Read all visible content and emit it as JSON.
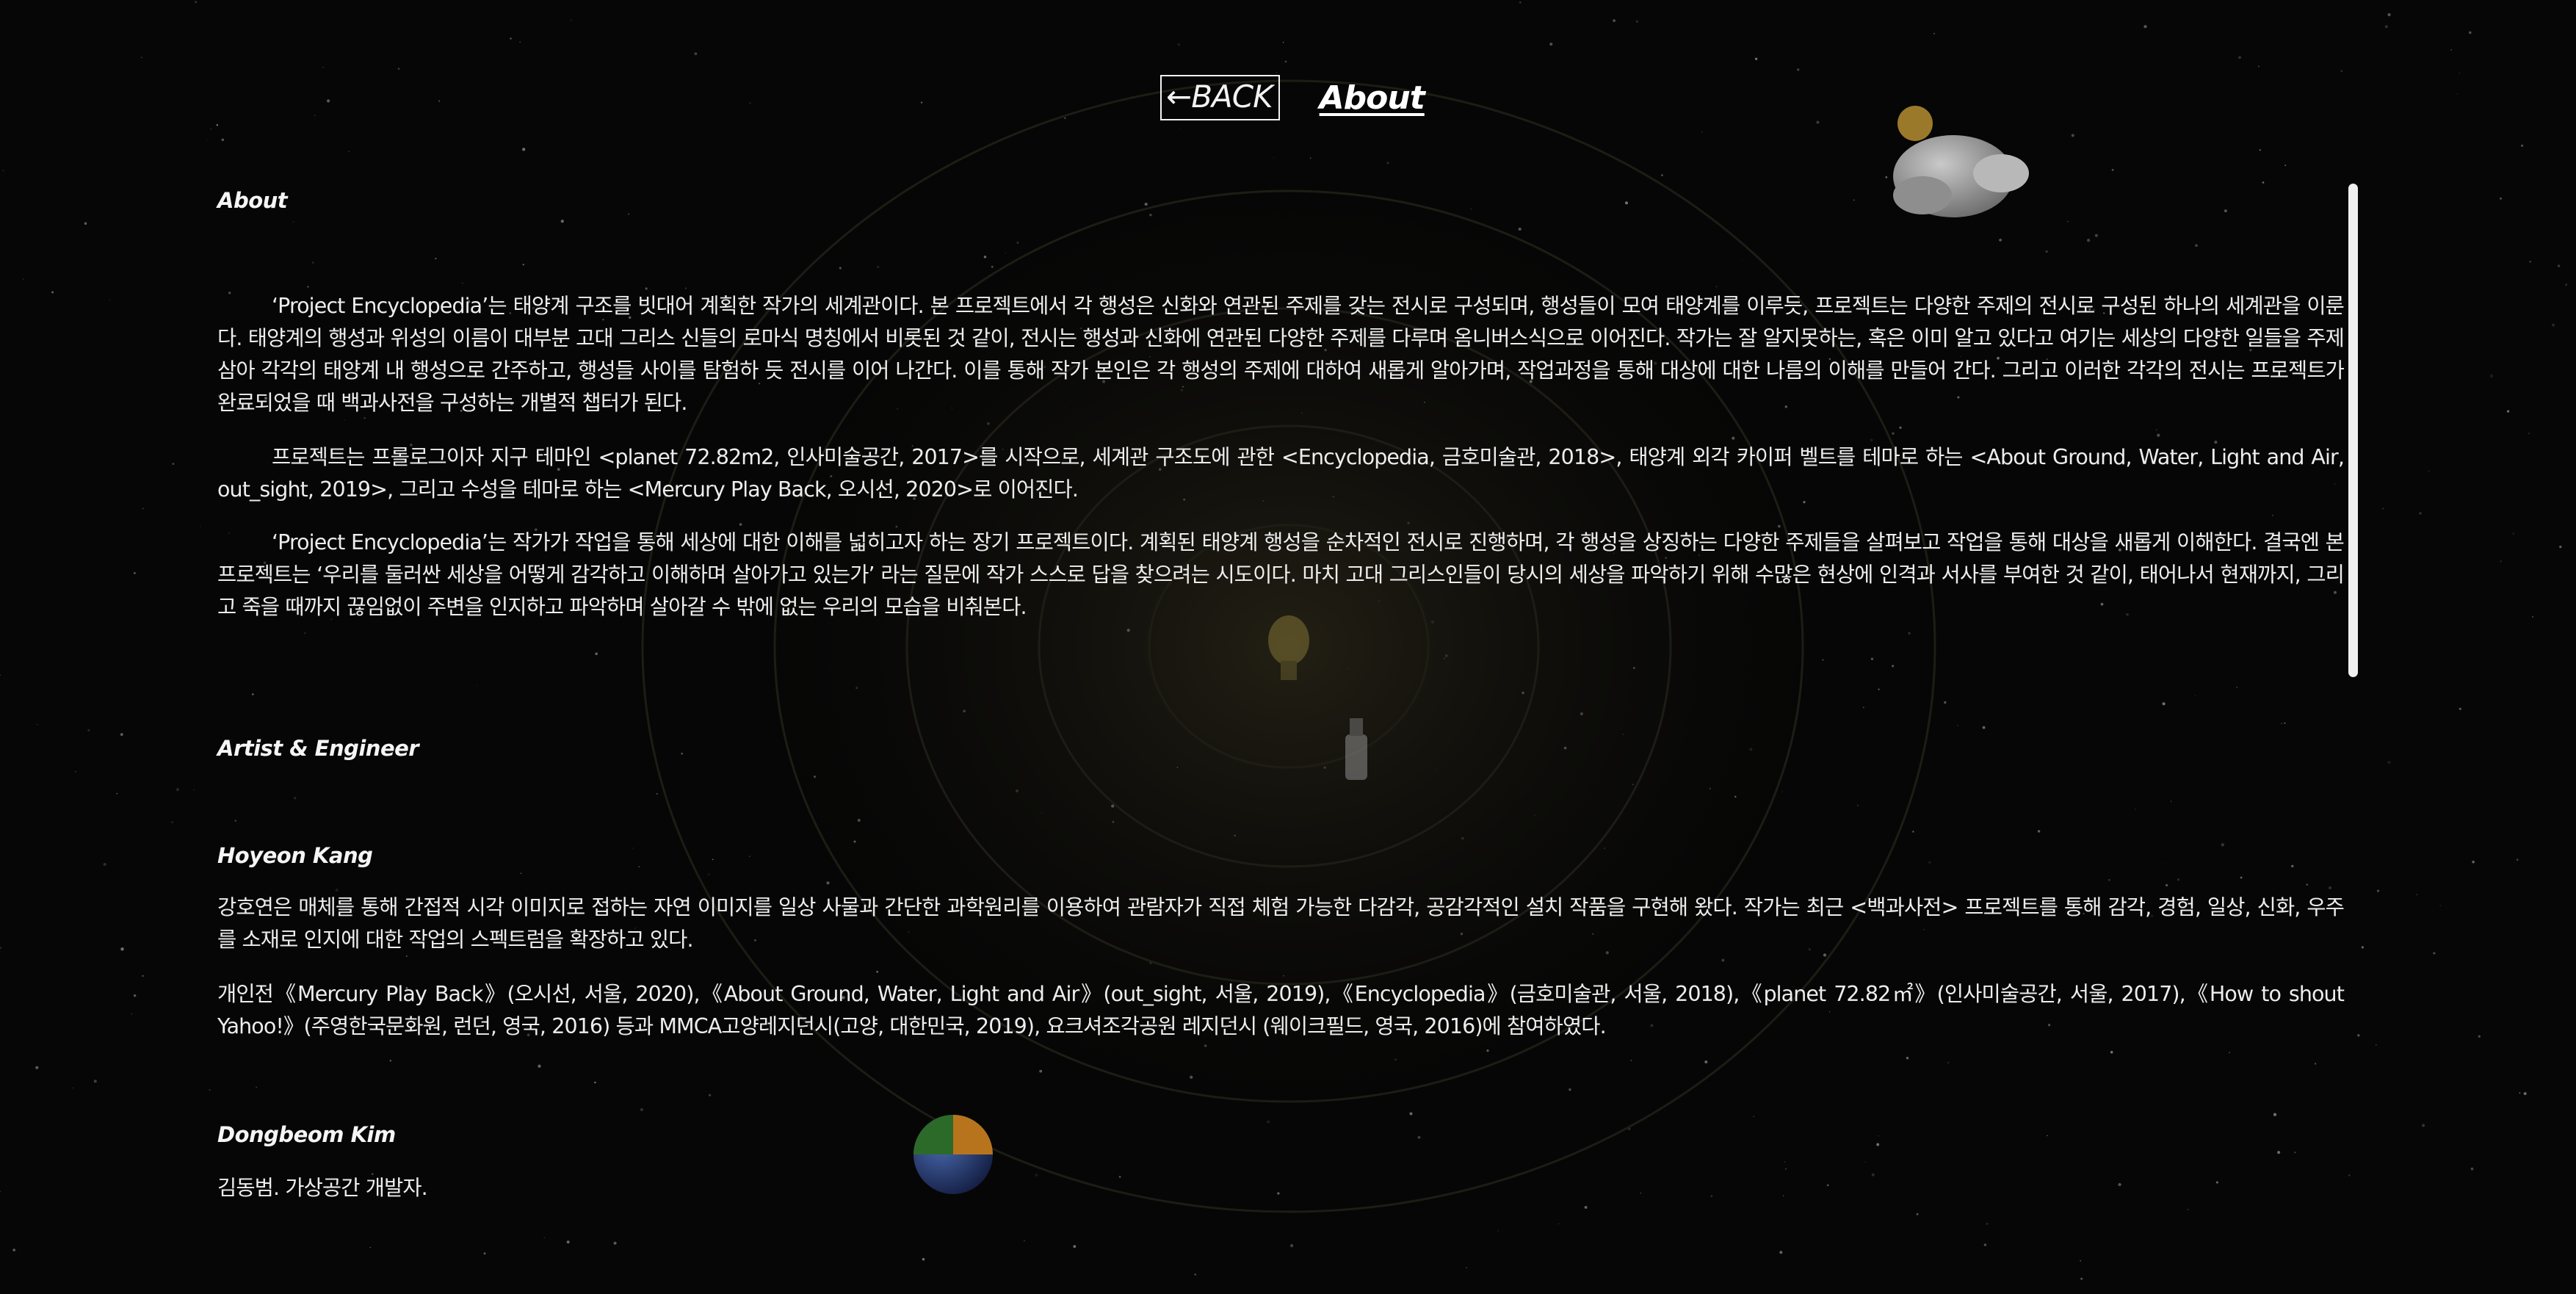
{
  "nav": {
    "back_label": "←BACK",
    "about_label": "About"
  },
  "about": {
    "heading": "About",
    "paragraphs": [
      "‘Project Encyclopedia’는 태양계 구조를 빗대어 계획한 작가의 세계관이다. 본 프로젝트에서 각 행성은 신화와 연관된 주제를 갖는 전시로 구성되며, 행성들이 모여 태양계를 이루듯, 프로젝트는 다양한 주제의 전시로 구성된 하나의 세계관을 이룬다. 태양계의 행성과 위성의 이름이 대부분 고대 그리스 신들의 로마식 명칭에서 비롯된 것 같이, 전시는 행성과 신화에 연관된 다양한 주제를 다루며 옴니버스식으로 이어진다. 작가는 잘 알지못하는, 혹은 이미 알고 있다고 여기는 세상의 다양한 일들을 주제 삼아 각각의 태양계 내 행성으로 간주하고, 행성들 사이를 탐험하 듯 전시를 이어 나간다. 이를 통해 작가 본인은 각 행성의 주제에 대하여 새롭게 알아가며, 작업과정을 통해 대상에 대한 나름의 이해를 만들어 간다. 그리고 이러한 각각의 전시는 프로젝트가 완료되었을 때 백과사전을 구성하는 개별적 챕터가 된다.",
      "프로젝트는 프롤로그이자 지구 테마인 <planet 72.82m2, 인사미술공간, 2017>를 시작으로, 세계관 구조도에 관한 <Encyclopedia, 금호미술관, 2018>, 태양계 외각 카이퍼 벨트를 테마로 하는 <About Ground, Water, Light and Air, out_sight, 2019>, 그리고 수성을 테마로 하는 <Mercury Play Back, 오시선, 2020>로 이어진다.",
      "‘Project Encyclopedia’는 작가가 작업을 통해 세상에 대한 이해를 넓히고자 하는 장기 프로젝트이다. 계획된 태양계 행성을 순차적인 전시로 진행하며, 각 행성을 상징하는 다양한 주제들을 살펴보고 작업을 통해 대상을 새롭게 이해한다. 결국엔 본 프로젝트는 ‘우리를 둘러싼 세상을 어떻게 감각하고 이해하며 살아가고 있는가’ 라는 질문에 작가 스스로 답을 찾으려는 시도이다. 마치 고대 그리스인들이 당시의 세상을 파악하기 위해 수많은 현상에 인격과 서사를 부여한 것 같이, 태어나서 현재까지, 그리고 죽을 때까지 끊임없이 주변을 인지하고 파악하며 살아갈 수 밖에 없는 우리의 모습을 비춰본다."
    ]
  },
  "credits": {
    "heading": "Artist & Engineer",
    "people": [
      {
        "name": "Hoyeon Kang",
        "paragraphs": [
          "강호연은 매체를 통해 간접적 시각 이미지로 접하는 자연 이미지를 일상 사물과 간단한 과학원리를 이용하여 관람자가 직접 체험 가능한 다감각, 공감각적인 설치 작품을 구현해 왔다. 작가는 최근 <백과사전> 프로젝트를 통해 감각, 경험, 일상, 신화, 우주를 소재로 인지에 대한 작업의 스펙트럼을 확장하고 있다.",
          "개인전《Mercury Play Back》(오시선, 서울, 2020),《About Ground, Water, Light and Air》(out_sight, 서울, 2019),《Encyclopedia》(금호미술관, 서울, 2018),《planet 72.82㎡》(인사미술공간, 서울, 2017),《How to shout Yahoo!》(주영한국문화원, 런던, 영국, 2016) 등과 MMCA고양레지던시(고양, 대한민국, 2019), 요크셔조각공원 레지던시 (웨이크필드, 영국, 2016)에 참여하였다."
        ]
      },
      {
        "name": "Dongbeom Kim",
        "paragraphs": [
          "김동범. 가상공간 개발자."
        ]
      }
    ]
  },
  "colors": {
    "background": "#060606",
    "text": "#ededed"
  }
}
